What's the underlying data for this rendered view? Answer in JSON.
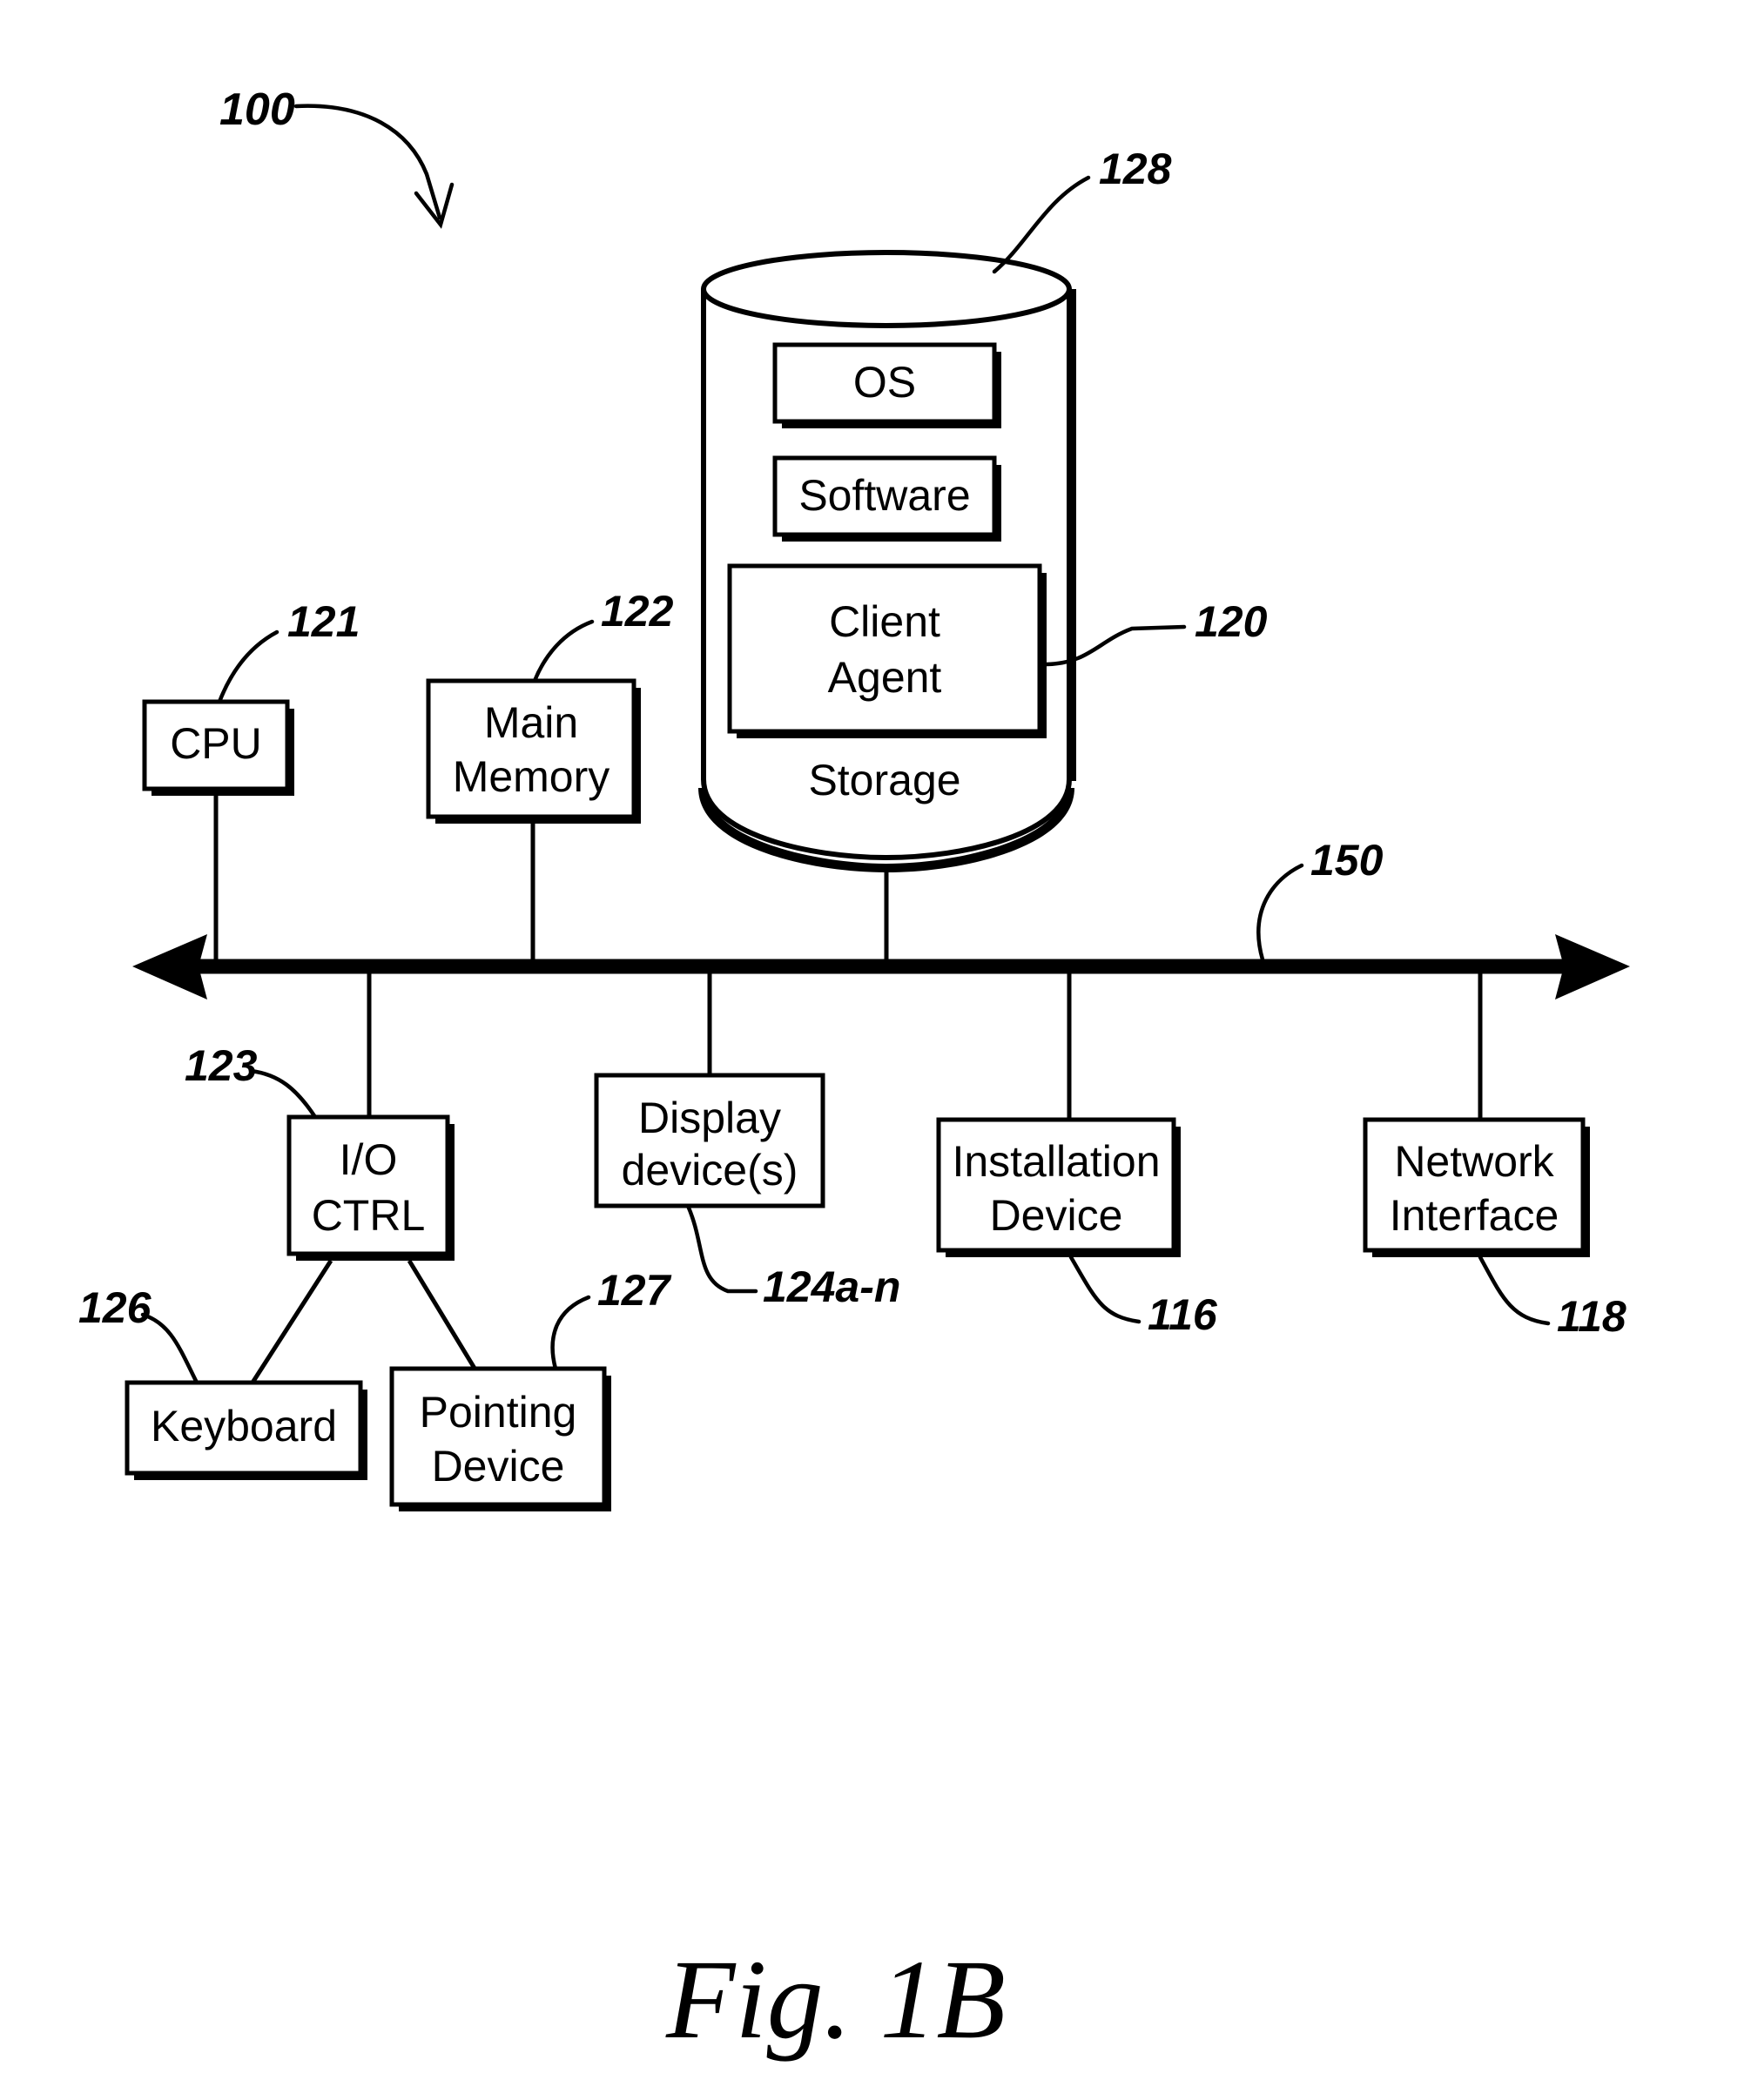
{
  "figure": {
    "caption": "Fig. 1B",
    "system_ref": "100"
  },
  "storage": {
    "label": "Storage",
    "ref": "128",
    "items": [
      {
        "label": "OS",
        "ref": ""
      },
      {
        "label": "Software",
        "ref": ""
      },
      {
        "label_line1": "Client",
        "label_line2": "Agent",
        "ref": "120"
      }
    ]
  },
  "components": [
    {
      "id": "cpu",
      "label_line1": "CPU",
      "label_line2": "",
      "ref": "121"
    },
    {
      "id": "main-memory",
      "label_line1": "Main",
      "label_line2": "Memory",
      "ref": "122"
    },
    {
      "id": "io-ctrl",
      "label_line1": "I/O",
      "label_line2": "CTRL",
      "ref": "123"
    },
    {
      "id": "display-devices",
      "label_line1": "Display",
      "label_line2": "device(s)",
      "ref": "124a-n"
    },
    {
      "id": "installation-device",
      "label_line1": "Installation",
      "label_line2": "Device",
      "ref": "116"
    },
    {
      "id": "network-interface",
      "label_line1": "Network",
      "label_line2": "Interface",
      "ref": "118"
    },
    {
      "id": "keyboard",
      "label_line1": "Keyboard",
      "label_line2": "",
      "ref": "126"
    },
    {
      "id": "pointing-device",
      "label_line1": "Pointing",
      "label_line2": "Device",
      "ref": "127"
    }
  ],
  "bus": {
    "ref": "150"
  },
  "colors": {
    "ink": "#000000",
    "paper": "#ffffff"
  }
}
